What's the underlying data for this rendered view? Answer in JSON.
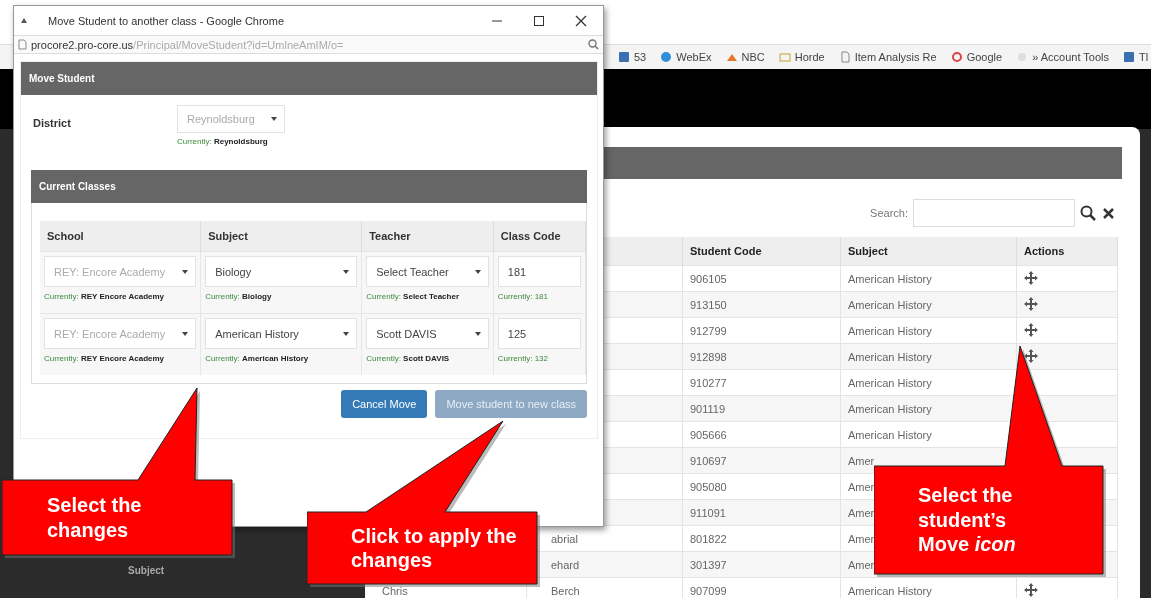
{
  "bookmarks": [
    {
      "label": "53",
      "kind": "app"
    },
    {
      "label": "WebEx",
      "kind": "globe"
    },
    {
      "label": "NBC",
      "kind": "peacock"
    },
    {
      "label": "Horde",
      "kind": "folder"
    },
    {
      "label": "Item Analysis Re",
      "kind": "page"
    },
    {
      "label": "Google",
      "kind": "google"
    },
    {
      "label": "» Account Tools",
      "kind": "blank"
    },
    {
      "label": "Tl",
      "kind": "app"
    }
  ],
  "page_behind": {
    "label": "Subject"
  },
  "modal": {
    "search": {
      "label": "Search:"
    },
    "table": {
      "columns": [
        "",
        "",
        "Student Code",
        "Subject",
        "Actions"
      ],
      "rows": [
        {
          "first": "",
          "last": "",
          "code": "906105",
          "subject": "American History",
          "kind": "movable"
        },
        {
          "first": "",
          "last": "",
          "code": "913150",
          "subject": "American History",
          "kind": "movable"
        },
        {
          "first": "",
          "last": "",
          "code": "912799",
          "subject": "American History",
          "kind": "movable"
        },
        {
          "first": "",
          "last": "",
          "code": "912898",
          "subject": "American History",
          "kind": "movable"
        },
        {
          "first": "",
          "last": "",
          "code": "910277",
          "subject": "American History"
        },
        {
          "first": "",
          "last": "",
          "code": "901119",
          "subject": "American History"
        },
        {
          "first": "",
          "last": "",
          "code": "905666",
          "subject": "American History"
        },
        {
          "first": "",
          "last": "",
          "code": "910697",
          "subject": "Amer"
        },
        {
          "first": "",
          "last": "",
          "code": "905080",
          "subject": "Amer"
        },
        {
          "first": "",
          "last": "",
          "code": "911091",
          "subject": "Amer"
        },
        {
          "first": "",
          "last": "abrial",
          "code": "801822",
          "subject": "Amer"
        },
        {
          "first": "",
          "last": "ehard",
          "code": "301397",
          "subject": "Amer"
        },
        {
          "first": "Chris",
          "last": "Berch",
          "code": "907099",
          "subject": "American History",
          "kind": "movable"
        }
      ]
    }
  },
  "popup": {
    "title": "Move Student to another class - Google Chrome",
    "url_host": "procore2.pro-core.us",
    "url_path": "/Principal/MoveStudent?id=UmlneAmIM/o=",
    "section_title": "Move Student",
    "district": {
      "label": "District",
      "value": "Reynoldsburg",
      "disabled": true,
      "current": "Currently: **Reynoldsburg**"
    },
    "classes_title": "Current Classes",
    "columns": [
      "School",
      "Subject",
      "Teacher",
      "Class Code"
    ],
    "rows": [
      {
        "cells": [
          {
            "value": "REY: Encore Academy",
            "disabled": true,
            "current": "Currently: **REY Encore Academy**",
            "kind": "select"
          },
          {
            "value": "Biology",
            "disabled": false,
            "current": "Currently: **Biology**",
            "kind": "select"
          },
          {
            "value": "Select Teacher",
            "disabled": false,
            "current": "Currently: **Select Teacher**",
            "kind": "select"
          },
          {
            "value": "181",
            "disabled": false,
            "current": "Currently: 181",
            "kind": "input"
          }
        ]
      },
      {
        "cells": [
          {
            "value": "REY: Encore Academy",
            "disabled": true,
            "current": "Currently: **REY Encore Academy**",
            "kind": "select"
          },
          {
            "value": "American History",
            "disabled": false,
            "current": "Currently: **American History**",
            "kind": "select"
          },
          {
            "value": "Scott DAVIS",
            "disabled": false,
            "current": "Currently: **Scott DAVIS**",
            "kind": "select"
          },
          {
            "value": "125",
            "disabled": false,
            "current": "Currently: 132",
            "kind": "input"
          }
        ]
      }
    ],
    "buttons": [
      {
        "label": "Cancel Move",
        "disabled": false
      },
      {
        "label": "Move student to new class",
        "disabled": true
      }
    ]
  },
  "callouts": [
    {
      "text": "Select the changes"
    },
    {
      "text": "Click to apply the changes"
    },
    {
      "text": "Select the student’s Move *icon*"
    }
  ]
}
